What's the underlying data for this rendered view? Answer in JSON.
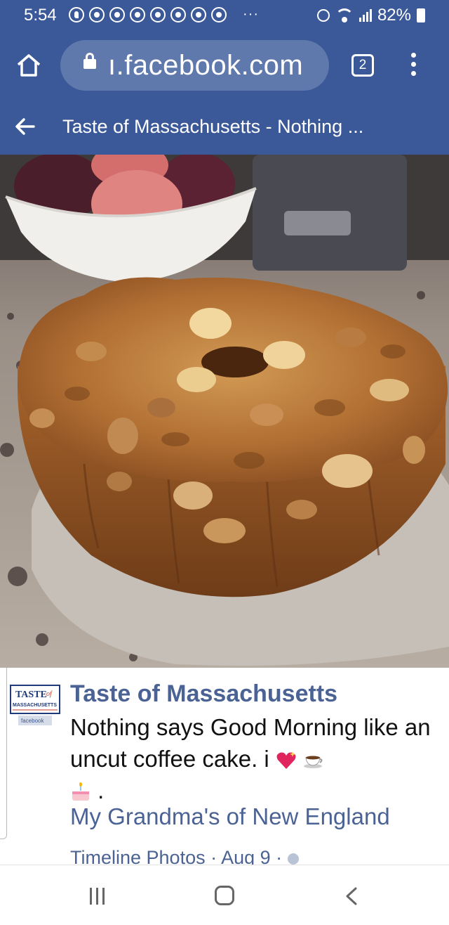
{
  "status_bar": {
    "time": "5:54",
    "battery": "82%",
    "overflow": "···",
    "notification_icons": [
      "pinterest-icon",
      "chrome-icon",
      "chrome-icon",
      "chrome-icon",
      "chrome-icon",
      "chrome-icon",
      "chrome-icon",
      "chrome-icon"
    ]
  },
  "browser": {
    "url": "ı.facebook.com",
    "tab_count": "2"
  },
  "header": {
    "title": "Taste of Massachusetts - Nothing ..."
  },
  "post": {
    "page_name": "Taste of Massachusetts",
    "text": "Nothing says Good Morning like an uncut coffee cake. i",
    "text_tail": ".",
    "album": "My Grandma's of New England",
    "meta": "Timeline Photos · Aug 9 ·",
    "logo_text": {
      "line1": "TASTE",
      "line1b": "of",
      "line2": "MASSACHUSETTS",
      "line3": "facebook"
    }
  },
  "colors": {
    "facebook_blue": "#3b5998",
    "link_blue": "#4b6394",
    "url_pill": "#5f79ad"
  }
}
